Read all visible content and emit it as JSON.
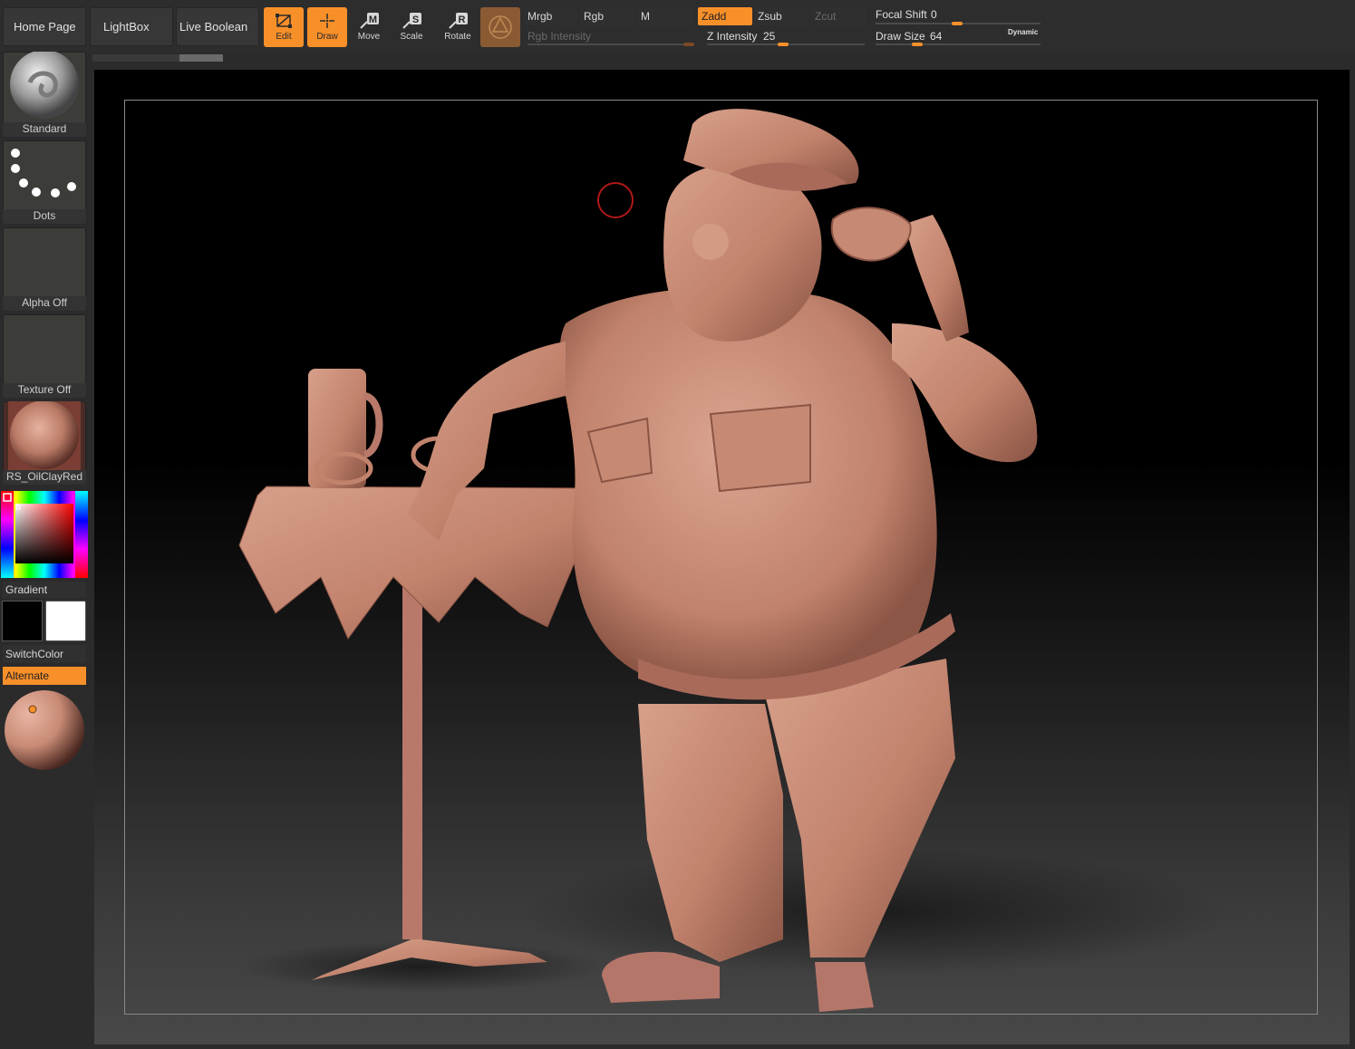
{
  "topbar": {
    "home_label": "Home Page",
    "lightbox_label": "LightBox",
    "live_boolean_label": "Live Boolean",
    "tools": {
      "edit": "Edit",
      "draw": "Draw",
      "move": "Move",
      "scale": "Scale",
      "rotate": "Rotate"
    },
    "modes": {
      "mrgb": "Mrgb",
      "rgb": "Rgb",
      "m": "M",
      "zadd": "Zadd",
      "zsub": "Zsub",
      "zcut": "Zcut"
    },
    "rgb_intensity": {
      "label": "Rgb Intensity",
      "value": ""
    },
    "z_intensity": {
      "label": "Z Intensity",
      "value": "25"
    },
    "focal_shift": {
      "label": "Focal Shift",
      "value": "0"
    },
    "draw_size": {
      "label": "Draw Size",
      "value": "64"
    },
    "dynamic_label": "Dynamic"
  },
  "leftpanel": {
    "brush_label": "Standard",
    "stroke_label": "Dots",
    "alpha_label": "Alpha Off",
    "texture_label": "Texture Off",
    "material_label": "RS_OilClayRed",
    "gradient_label": "Gradient",
    "switchcolor_label": "SwitchColor",
    "alternate_label": "Alternate"
  },
  "colors": {
    "accent": "#f8902a",
    "clay": "#c98a74",
    "panel": "#2b2b2b",
    "main_color": "#000000",
    "secondary_color": "#ffffff"
  }
}
